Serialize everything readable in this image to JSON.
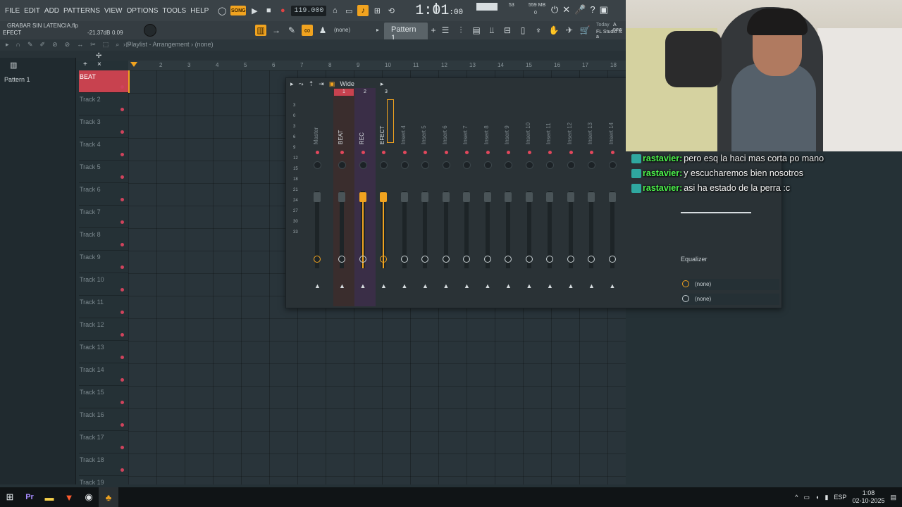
{
  "menu": [
    "FILE",
    "EDIT",
    "ADD",
    "PATTERNS",
    "VIEW",
    "OPTIONS",
    "TOOLS",
    "HELP"
  ],
  "transport": {
    "song_label": "SONG",
    "tempo": "119.000",
    "time_main": "1:01",
    "time_sub": ":00",
    "cpu": "53",
    "mem": "559 MB",
    "voices": "0"
  },
  "project": {
    "name": "GRABAR SIN LATENCIA.flp",
    "selected": "EFECT",
    "db": "-21.37dB",
    "val": "0.09"
  },
  "toolbar": {
    "pattern": "Pattern 1",
    "none": "(none)",
    "hint_today": "Today",
    "hint_new": "A new",
    "hint_fl": "FL Studio is a"
  },
  "playlist": {
    "title": "Playlist - Arrangement",
    "title_sep": "›",
    "arrangement": "(none)",
    "pattern_list": [
      "Pattern 1"
    ],
    "ruler": [
      "2",
      "3",
      "4",
      "5",
      "6",
      "7",
      "8",
      "9",
      "10",
      "11",
      "12",
      "13",
      "14",
      "15",
      "16",
      "17",
      "18"
    ],
    "tracks": [
      "BEAT",
      "Track 2",
      "Track 3",
      "Track 4",
      "Track 5",
      "Track 6",
      "Track 7",
      "Track 8",
      "Track 9",
      "Track 10",
      "Track 11",
      "Track 12",
      "Track 13",
      "Track 14",
      "Track 15",
      "Track 16",
      "Track 17",
      "Track 18",
      "Track 19"
    ]
  },
  "mixer": {
    "layout": "Wide",
    "inserts": [
      "Master",
      "BEAT",
      "REC",
      "EFECT",
      "Insert 4",
      "Insert 5",
      "Insert 6",
      "Insert 7",
      "Insert 8",
      "Insert 9",
      "Insert 10",
      "Insert 11",
      "Insert 12",
      "Insert 13",
      "Insert 14"
    ],
    "scale": [
      "3",
      "0",
      "3",
      "6",
      "9",
      "12",
      "15",
      "18",
      "21",
      "24",
      "27",
      "30",
      "33"
    ],
    "numbers": [
      "1",
      "2",
      "3"
    ],
    "slot_label": "Equalizer",
    "slots": [
      "(none)",
      "(none)"
    ]
  },
  "chat": [
    {
      "user": "rastavier:",
      "msg": "pero esq la haci mas corta po mano"
    },
    {
      "user": "rastavier:",
      "msg": "y escucharemos bien nosotros"
    },
    {
      "user": "rastavier:",
      "msg": "asi ha estado de la perra :c"
    }
  ],
  "taskbar": {
    "lang": "ESP",
    "time": "1:08",
    "date": "02-10-2025"
  },
  "colors": {
    "accent": "#f1a31f",
    "track_red": "#c8424f",
    "chat_user": "#4cf24c"
  }
}
